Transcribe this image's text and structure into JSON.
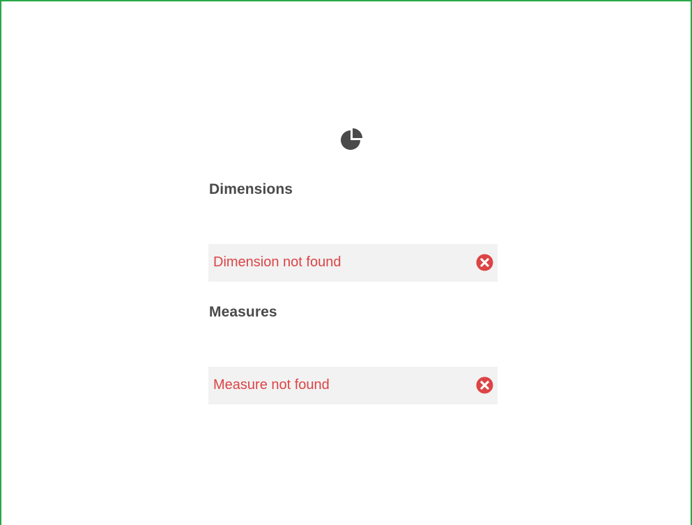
{
  "icons": {
    "chart_type": "pie-chart-icon",
    "error": "error-circle-x-icon"
  },
  "colors": {
    "frame_border": "#27a847",
    "heading_text": "#4a4a4a",
    "error_text": "#dc4446",
    "row_background": "#f2f2f2",
    "icon_dark": "#4a4a4a"
  },
  "dimensions": {
    "heading": "Dimensions",
    "items": [
      {
        "label": "Dimension not found",
        "status": "error"
      }
    ]
  },
  "measures": {
    "heading": "Measures",
    "items": [
      {
        "label": "Measure not found",
        "status": "error"
      }
    ]
  }
}
